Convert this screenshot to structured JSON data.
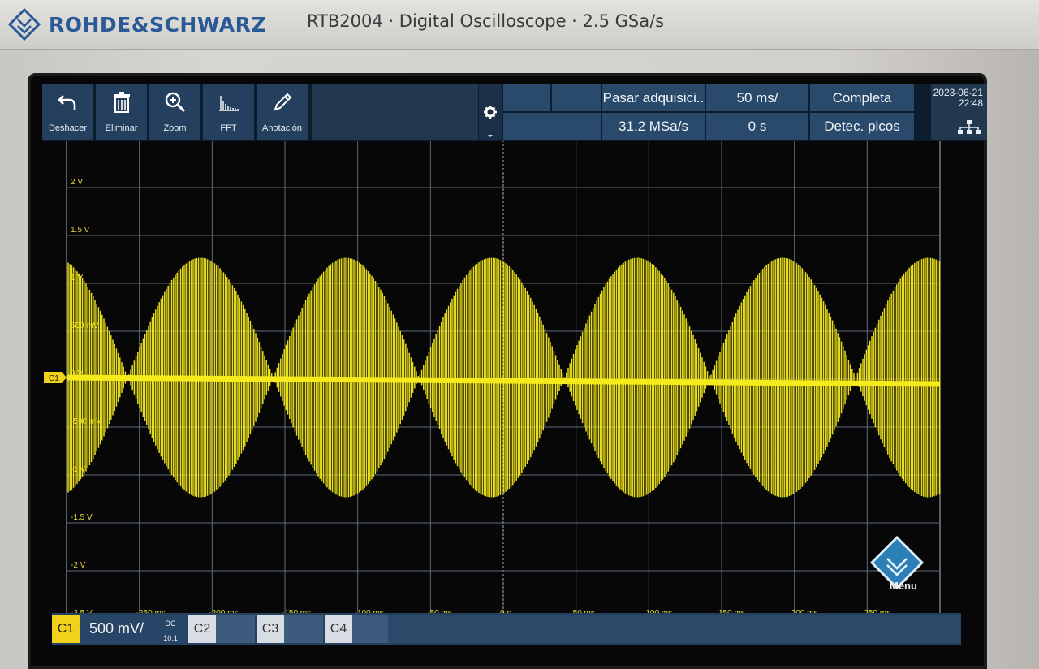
{
  "brand": {
    "name": "ROHDE&SCHWARZ",
    "model_line": "RTB2004 · Digital Oscilloscope · 2.5 GSa/s"
  },
  "toolbar": {
    "buttons": [
      {
        "label": "Deshacer",
        "icon": "undo-icon"
      },
      {
        "label": "Eliminar",
        "icon": "trash-icon"
      },
      {
        "label": "Zoom",
        "icon": "zoom-icon"
      },
      {
        "label": "FFT",
        "icon": "fft-icon"
      },
      {
        "label": "Anotación",
        "icon": "pencil-icon"
      }
    ]
  },
  "acquisition": {
    "mode": "Pasar adquisici..",
    "sample_rate": "31.2 MSa/s",
    "time_scale": "50 ms/",
    "time_offset": "0 s",
    "record": "Completa",
    "decimation": "Detec. picos"
  },
  "datetime": {
    "date": "2023-06-21",
    "time": "22:48"
  },
  "grid": {
    "voltage_labels": [
      "2 V",
      "1.5 V",
      "1 V",
      "500 mV",
      "0 V",
      "-500 mV",
      "-1 V",
      "-1.5 V",
      "-2 V",
      "-2.5 V"
    ],
    "time_labels": [
      "-250 ms",
      "-200 ms",
      "-150 ms",
      "-100 ms",
      "-50 ms",
      "0 s",
      "50 ms",
      "100 ms",
      "150 ms",
      "200 ms",
      "250 ms"
    ]
  },
  "waveform": {
    "type": "AM modulated sine (peak envelope)",
    "carrier_scale": "500 mV/",
    "envelope_peak_v": 1.25,
    "envelope_period_ms": 100,
    "color": "#f4ea1c"
  },
  "channel_bar": {
    "c1_label": "C1",
    "c1_scale": "500 mV/",
    "c1_coupling": "DC",
    "c1_probe": "10:1",
    "channels": [
      "C2",
      "C3",
      "C4"
    ],
    "marker": "C1"
  },
  "menu": {
    "label": "Menu"
  },
  "colors": {
    "toolbar": "#253f5e",
    "channel1": "#f1d21a",
    "grid": "#6c7c8c",
    "bezel": "#d2d0cc"
  }
}
